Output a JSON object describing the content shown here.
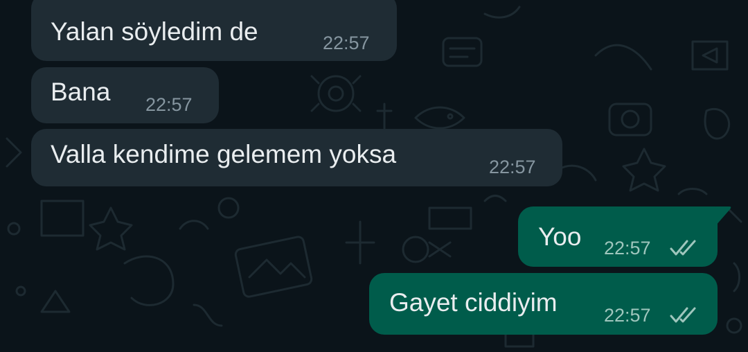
{
  "theme": {
    "background": "#0b141a",
    "incoming_bubble": "#1f2c34",
    "outgoing_bubble": "#005c4b",
    "text": "#e9edef",
    "time_in": "#8696a0",
    "time_out": "#9fc6bd"
  },
  "messages": [
    {
      "direction": "incoming",
      "text": "Yalan söyledim de",
      "time": "22:57"
    },
    {
      "direction": "incoming",
      "text": "Bana",
      "time": "22:57"
    },
    {
      "direction": "incoming",
      "text": "Valla kendime gelemem yoksa",
      "time": "22:57"
    },
    {
      "direction": "outgoing",
      "text": "Yoo",
      "time": "22:57",
      "status_icon": "double-check-icon"
    },
    {
      "direction": "outgoing",
      "text": "Gayet ciddiyim",
      "time": "22:57",
      "status_icon": "double-check-icon"
    }
  ]
}
